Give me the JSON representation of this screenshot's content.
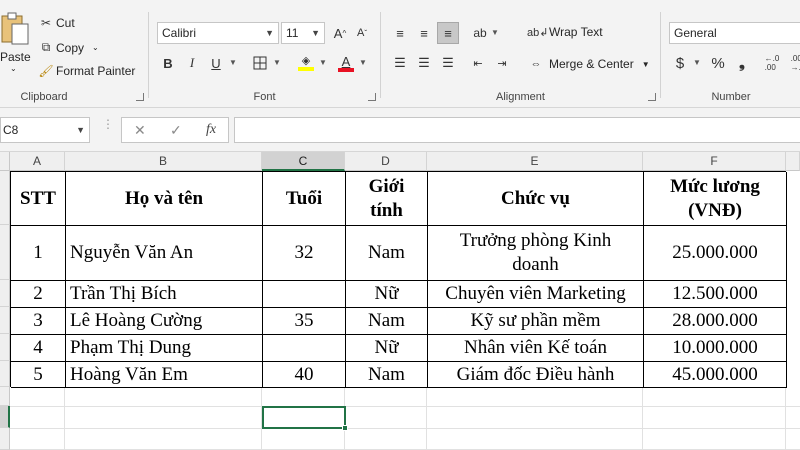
{
  "ribbon": {
    "clipboard": {
      "label": "Clipboard",
      "paste": "Paste",
      "cut": "Cut",
      "copy": "Copy",
      "format_painter": "Format Painter"
    },
    "font": {
      "label": "Font",
      "font_name": "Calibri",
      "font_size": "11",
      "bold": "B",
      "italic": "I",
      "underline": "U",
      "font_color": "#e81123",
      "highlight_color": "#ffff00"
    },
    "alignment": {
      "label": "Alignment",
      "wrap_text": "Wrap Text",
      "merge_center": "Merge & Center"
    },
    "number": {
      "label": "Number",
      "format": "General",
      "currency": "$",
      "percent": "%",
      "comma": "❟",
      "inc_decimal": "←.0\n.00"
    }
  },
  "formula_bar": {
    "name_box": "C8",
    "cancel": "✕",
    "enter": "✓",
    "fx": "fx",
    "value": ""
  },
  "grid": {
    "columns": [
      "A",
      "B",
      "C",
      "D",
      "E",
      "F"
    ],
    "selected_column": "C",
    "selected_cell": "C8",
    "table_headers": [
      "STT",
      "Họ và tên",
      "Tuổi",
      "Giới tính",
      "Chức vụ",
      "Mức lương (VNĐ)"
    ],
    "rows": [
      [
        "1",
        "Nguyễn Văn An",
        "32",
        "Nam",
        "Trưởng phòng Kinh doanh",
        "25.000.000"
      ],
      [
        "2",
        "Trần Thị Bích",
        "",
        "Nữ",
        "Chuyên viên Marketing",
        "12.500.000"
      ],
      [
        "3",
        "Lê Hoàng Cường",
        "35",
        "Nam",
        "Kỹ sư phần mềm",
        "28.000.000"
      ],
      [
        "4",
        "Phạm Thị Dung",
        "",
        "Nữ",
        "Nhân viên Kế toán",
        "10.000.000"
      ],
      [
        "5",
        "Hoàng Văn Em",
        "40",
        "Nam",
        "Giám đốc Điều hành",
        "45.000.000"
      ]
    ]
  },
  "colors": {
    "accent": "#217346",
    "header_bg": "#efefef",
    "ribbon_bg": "#f3f3f3"
  }
}
